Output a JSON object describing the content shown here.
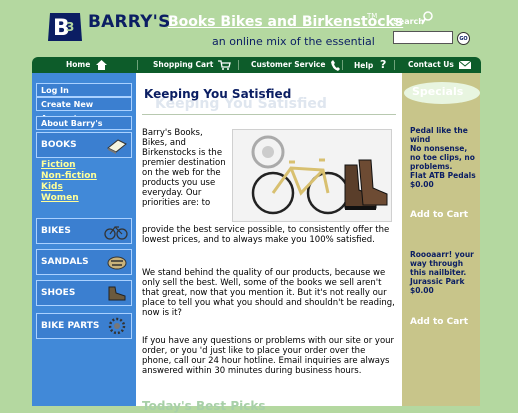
{
  "header": {
    "brand_name": "BARRY'S",
    "brand_rest": "Books Bikes and Birkenstocks",
    "trademark": "TM",
    "tagline": "an online mix of the essential",
    "search_label": "Search",
    "go_label": "GO"
  },
  "nav": {
    "items": [
      {
        "label": "Home",
        "icon": "house-icon"
      },
      {
        "label": "Shopping Cart",
        "icon": "cart-icon"
      },
      {
        "label": "Customer Service",
        "icon": "phone-icon"
      },
      {
        "label": "Help",
        "icon": "question-icon"
      },
      {
        "label": "Contact Us",
        "icon": "envelope-icon"
      }
    ]
  },
  "sidebar": {
    "account_links": [
      "Log In",
      "Create New Account"
    ],
    "about_link": "About Barry's",
    "categories": [
      {
        "label": "BOOKS",
        "icon": "book-icon"
      },
      {
        "label": "BIKES",
        "icon": "bike-icon"
      },
      {
        "label": "SANDALS",
        "icon": "sandal-icon"
      },
      {
        "label": "SHOES",
        "icon": "shoe-icon"
      },
      {
        "label": "BIKE PARTS",
        "icon": "gear-icon"
      }
    ],
    "book_sublinks": [
      "Fiction",
      "Non-fiction",
      "Kids",
      "Women"
    ]
  },
  "main": {
    "title": "Keeping You Satisfied",
    "ghost_title": "Keeping You Satisfied",
    "intro": "Barry's Books, Bikes, and Birkenstocks is the premier destination on the web for the products you use everyday. Our priorities are: to",
    "intro_cont": "provide the best service possible, to consistently offer the lowest prices, and to always make you 100% satisfied.",
    "para2": "We stand behind the quality of our products, because we only sell the best. Well, some of the books we sell aren't that great, now that you mention it. But it's not really our place to tell you what you should and shouldn't be reading, now is it?",
    "para3": "If you have any questions or problems with our site or your order, or you 'd just like to place your order over the phone, call our 24 hour hotline. Email inquiries are always answered within 30 minutes during business hours.",
    "bottom_ghost": "Today's Best Picks"
  },
  "specials": {
    "heading": "Specials",
    "items": [
      {
        "text": "Pedal like the wind\nNo nonsense, no toe clips, no problems.\nFlat ATB Pedals\n$0.00",
        "cta": "Add to Cart"
      },
      {
        "text": "Roooaarr! your way through this nailbiter.\nJurassic Park\n$0.00",
        "cta": "Add to Cart"
      }
    ]
  },
  "colors": {
    "background_green": "#b4d8a0",
    "navy": "#0b1e63",
    "nav_green": "#0d5c2a",
    "sidebar_blue": "#4189d8",
    "specials_tan": "#c8c58a"
  }
}
